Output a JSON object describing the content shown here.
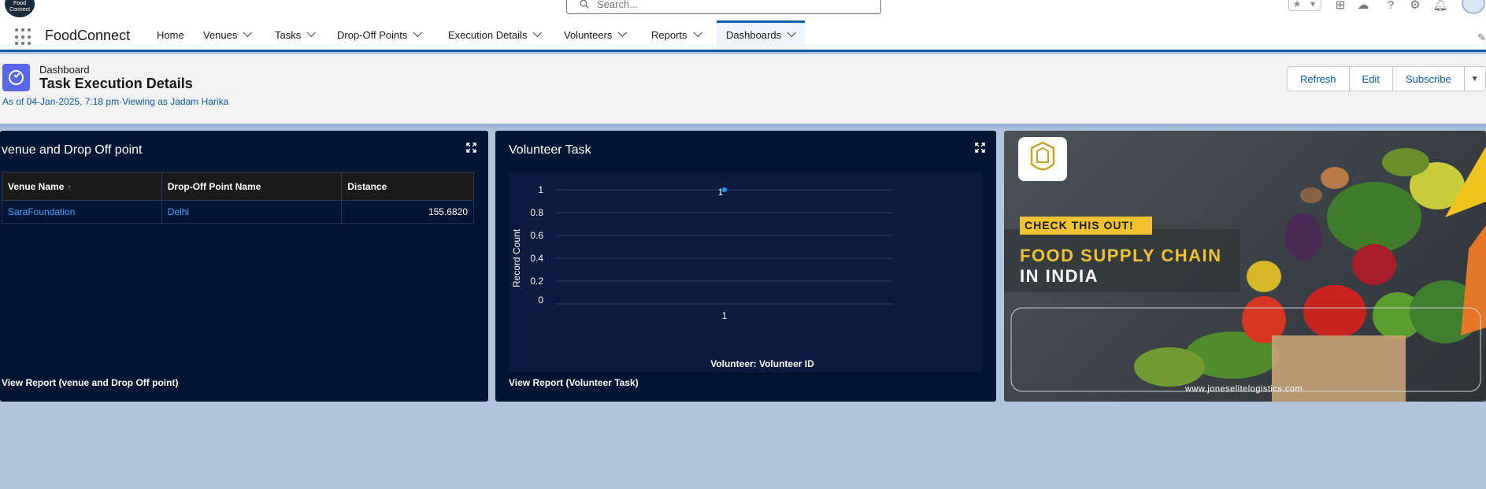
{
  "header": {
    "logo_text": "Food Connect",
    "search_placeholder": "Search..."
  },
  "nav": {
    "app_name": "FoodConnect",
    "items": [
      {
        "label": "Home",
        "has_menu": false
      },
      {
        "label": "Venues",
        "has_menu": true
      },
      {
        "label": "Tasks",
        "has_menu": true
      },
      {
        "label": "Drop-Off Points",
        "has_menu": true
      },
      {
        "label": "Execution Details",
        "has_menu": true
      },
      {
        "label": "Volunteers",
        "has_menu": true
      },
      {
        "label": "Reports",
        "has_menu": true
      },
      {
        "label": "Dashboards",
        "has_menu": true,
        "active": true
      }
    ]
  },
  "dashboard": {
    "breadcrumb": "Dashboard",
    "title": "Task Execution Details",
    "as_of": "As of 04-Jan-2025, 7:18 pm·Viewing as Jadam Harika",
    "buttons": {
      "refresh": "Refresh",
      "edit": "Edit",
      "subscribe": "Subscribe"
    }
  },
  "venue_card": {
    "title": "venue and Drop Off point",
    "columns": [
      "Venue Name",
      "Drop-Off Point Name",
      "Distance"
    ],
    "sort_indicator": "↑",
    "rows": [
      {
        "venue": "SaraFoundation",
        "dropoff": "Delhi",
        "distance": "155.6820"
      }
    ],
    "view_report": "View Report (venue and Drop Off point)"
  },
  "volunteer_card": {
    "title": "Volunteer Task",
    "view_report": "View Report (Volunteer Task)"
  },
  "chart_data": {
    "type": "scatter",
    "title": "Volunteer Task",
    "xlabel": "Volunteer: Volunteer ID",
    "ylabel": "Record Count",
    "categories": [
      "1"
    ],
    "values": [
      1
    ],
    "data_labels": [
      "1"
    ],
    "y_ticks": [
      "0",
      "0.2",
      "0.4",
      "0.6",
      "0.8",
      "1"
    ],
    "ylim": [
      0,
      1
    ],
    "grid": true,
    "point_color": "#1b96ff"
  },
  "ad": {
    "badge": "CHECK THIS OUT!",
    "headline_1": "FOOD SUPPLY CHAIN",
    "headline_2": "IN INDIA",
    "url": "www.joneselitelogistics.com"
  },
  "colors": {
    "brand_blue": "#0b5cab",
    "card_bg": "#021535",
    "canvas_bg": "#b0c4de",
    "ad_yellow": "#f2c230"
  }
}
